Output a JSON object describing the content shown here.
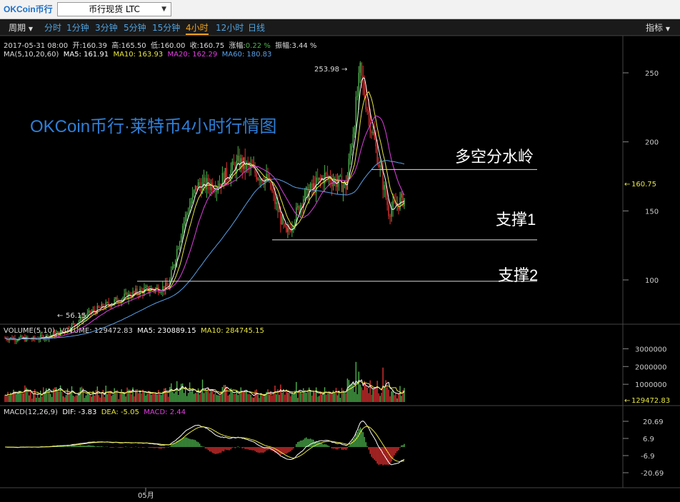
{
  "header": {
    "logo_text": "OKCoin币行",
    "symbol_select": "币行现货 LTC"
  },
  "periods": {
    "menu_label": "周期",
    "items": [
      "分时",
      "1分钟",
      "3分钟",
      "5分钟",
      "15分钟",
      "4小时",
      "12小时",
      "日线"
    ],
    "active": "4小时",
    "indicator_label": "指标"
  },
  "ohlc": {
    "date": "2017-05-31 08:00",
    "open_label": "开:",
    "open": "160.39",
    "high_label": "高:",
    "high": "165.50",
    "low_label": "低:",
    "low": "160.00",
    "close_label": "收:",
    "close": "160.75",
    "change_label": "涨幅:",
    "change": "0.22 %",
    "amplitude_label": "振幅:",
    "amplitude": "3.44 %"
  },
  "ma_legend": {
    "label": "MA(5,10,20,60)",
    "ma5": "MA5: 161.91",
    "ma10": "MA10: 163.93",
    "ma20": "MA20: 162.29",
    "ma60": "MA60: 180.83"
  },
  "volume_legend": {
    "label": "VOLUME(5,10)",
    "volume": "VOLUME: 129472.83",
    "ma5": "MA5: 230889.15",
    "ma10": "MA10: 284745.15"
  },
  "macd_legend": {
    "label": "MACD(12,26,9)",
    "dif": "DIF: -3.83",
    "dea": "DEA: -5.05",
    "macd": "MACD: 2.44"
  },
  "overlay": {
    "title": "OKCoin币行·莱特币4小时行情图",
    "watershed": "多空分水岭",
    "support1": "支撑1",
    "support2": "支撑2"
  },
  "annotations": {
    "high_marker": "253.98",
    "low_marker": "56.15",
    "last_price": "160.75",
    "last_volume": "129472.83",
    "x_label": "05月"
  },
  "colors": {
    "up": "#4db34d",
    "down": "#e03030",
    "ma5": "#ffffff",
    "ma10": "#e8e840",
    "ma20": "#e040e0",
    "ma60": "#5aa0e8",
    "accent": "#f3a21c"
  },
  "chart_data": [
    {
      "type": "candlestick",
      "title": "",
      "ylim": [
        40,
        270
      ],
      "y_ticks": [
        "250",
        "200",
        "150",
        "100"
      ],
      "key_points": [
        {
          "i": 0,
          "price": 58
        },
        {
          "i": 20,
          "price": 57
        },
        {
          "i": 40,
          "price": 62
        },
        {
          "i": 60,
          "price": 76
        },
        {
          "i": 80,
          "price": 86
        },
        {
          "i": 95,
          "price": 92
        },
        {
          "i": 115,
          "price": 95
        },
        {
          "i": 125,
          "price": 140
        },
        {
          "i": 135,
          "price": 168
        },
        {
          "i": 150,
          "price": 170
        },
        {
          "i": 165,
          "price": 185
        },
        {
          "i": 185,
          "price": 172
        },
        {
          "i": 198,
          "price": 132
        },
        {
          "i": 210,
          "price": 160
        },
        {
          "i": 225,
          "price": 175
        },
        {
          "i": 240,
          "price": 168
        },
        {
          "i": 250,
          "price": 250
        },
        {
          "i": 262,
          "price": 190
        },
        {
          "i": 270,
          "price": 150
        },
        {
          "i": 282,
          "price": 160
        }
      ],
      "candle_count": 282,
      "ma_legend": [
        "MA5",
        "MA10",
        "MA20",
        "MA60"
      ],
      "reference_lines": [
        {
          "label": "多空分水岭",
          "price": 180
        },
        {
          "label": "支撑1",
          "price": 129
        },
        {
          "label": "支撑2",
          "price": 99
        }
      ]
    },
    {
      "type": "bar",
      "title": "",
      "ylim": [
        0,
        3500000
      ],
      "y_ticks": [
        "3000000",
        "2000000",
        "1000000"
      ],
      "description_values": "volume per candle",
      "last": 129472.83
    },
    {
      "type": "bar",
      "title": "",
      "ylim": [
        -25,
        25
      ],
      "y_ticks": [
        "20.69",
        "6.9",
        "-6.9",
        "-20.69"
      ],
      "series": [
        {
          "name": "DIF"
        },
        {
          "name": "DEA"
        },
        {
          "name": "MACD"
        }
      ],
      "last": {
        "DIF": -3.83,
        "DEA": -5.05,
        "MACD": 2.44
      }
    }
  ]
}
